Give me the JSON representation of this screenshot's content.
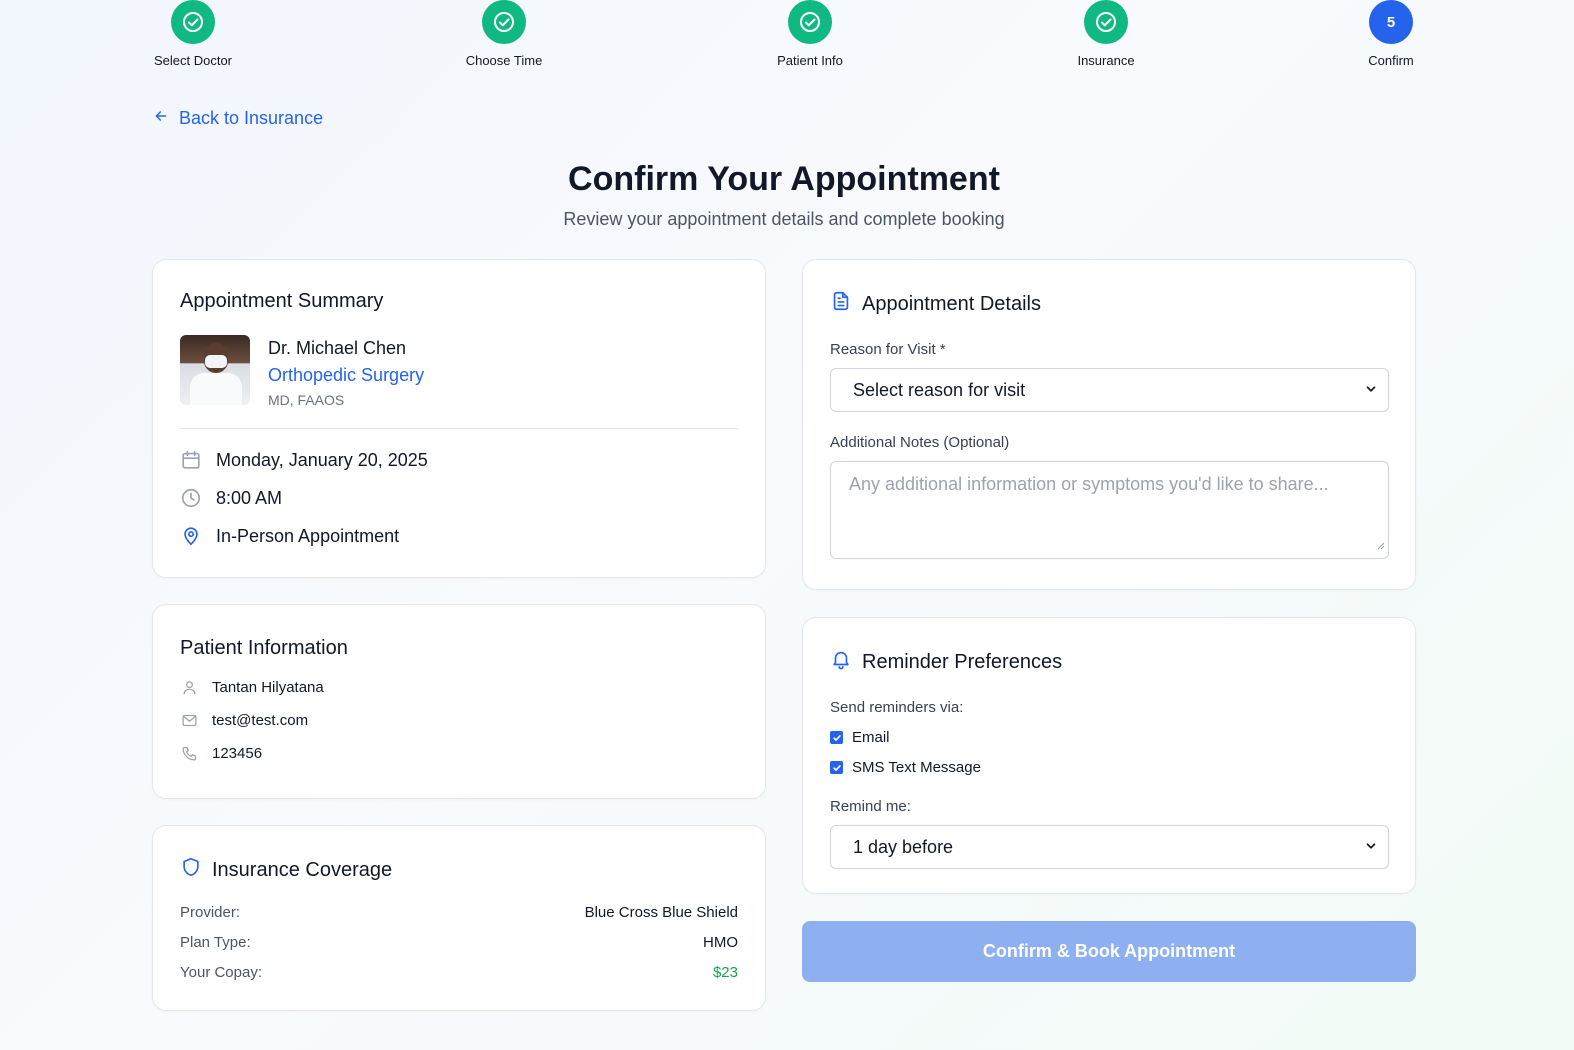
{
  "stepper": {
    "steps": [
      {
        "label": "Select Doctor",
        "status": "complete"
      },
      {
        "label": "Choose Time",
        "status": "complete"
      },
      {
        "label": "Patient Info",
        "status": "complete"
      },
      {
        "label": "Insurance",
        "status": "complete"
      },
      {
        "label": "Confirm",
        "number": "5",
        "status": "current"
      }
    ]
  },
  "back_link": {
    "label": "Back to Insurance",
    "icon": "arrow-left-icon"
  },
  "header": {
    "title": "Confirm Your Appointment",
    "subtitle": "Review your appointment details and complete booking"
  },
  "summary": {
    "title": "Appointment Summary",
    "doctor": {
      "name": "Dr. Michael Chen",
      "specialty": "Orthopedic Surgery",
      "credentials": "MD, FAAOS"
    },
    "date": "Monday, January 20, 2025",
    "time": "8:00 AM",
    "type": "In-Person Appointment"
  },
  "patient": {
    "title": "Patient Information",
    "name": "Tantan Hilyatana",
    "email": "test@test.com",
    "phone": "123456"
  },
  "insurance": {
    "title": "Insurance Coverage",
    "provider_label": "Provider:",
    "provider": "Blue Cross Blue Shield",
    "plan_label": "Plan Type:",
    "plan": "HMO",
    "copay_label": "Your Copay:",
    "copay": "$23"
  },
  "details": {
    "title": "Appointment Details",
    "reason_label": "Reason for Visit *",
    "reason_value": "Select reason for visit",
    "notes_label": "Additional Notes (Optional)",
    "notes_placeholder": "Any additional information or symptoms you'd like to share..."
  },
  "reminders": {
    "title": "Reminder Preferences",
    "via_label": "Send reminders via:",
    "email_label": "Email",
    "email_checked": true,
    "sms_label": "SMS Text Message",
    "sms_checked": true,
    "remind_label": "Remind me:",
    "remind_value": "1 day before"
  },
  "confirm_button": {
    "label": "Confirm & Book Appointment"
  },
  "colors": {
    "primary": "#2563eb",
    "success": "#10b981",
    "disabled_button": "#8fb0f0",
    "copay_green": "#16a34a"
  }
}
